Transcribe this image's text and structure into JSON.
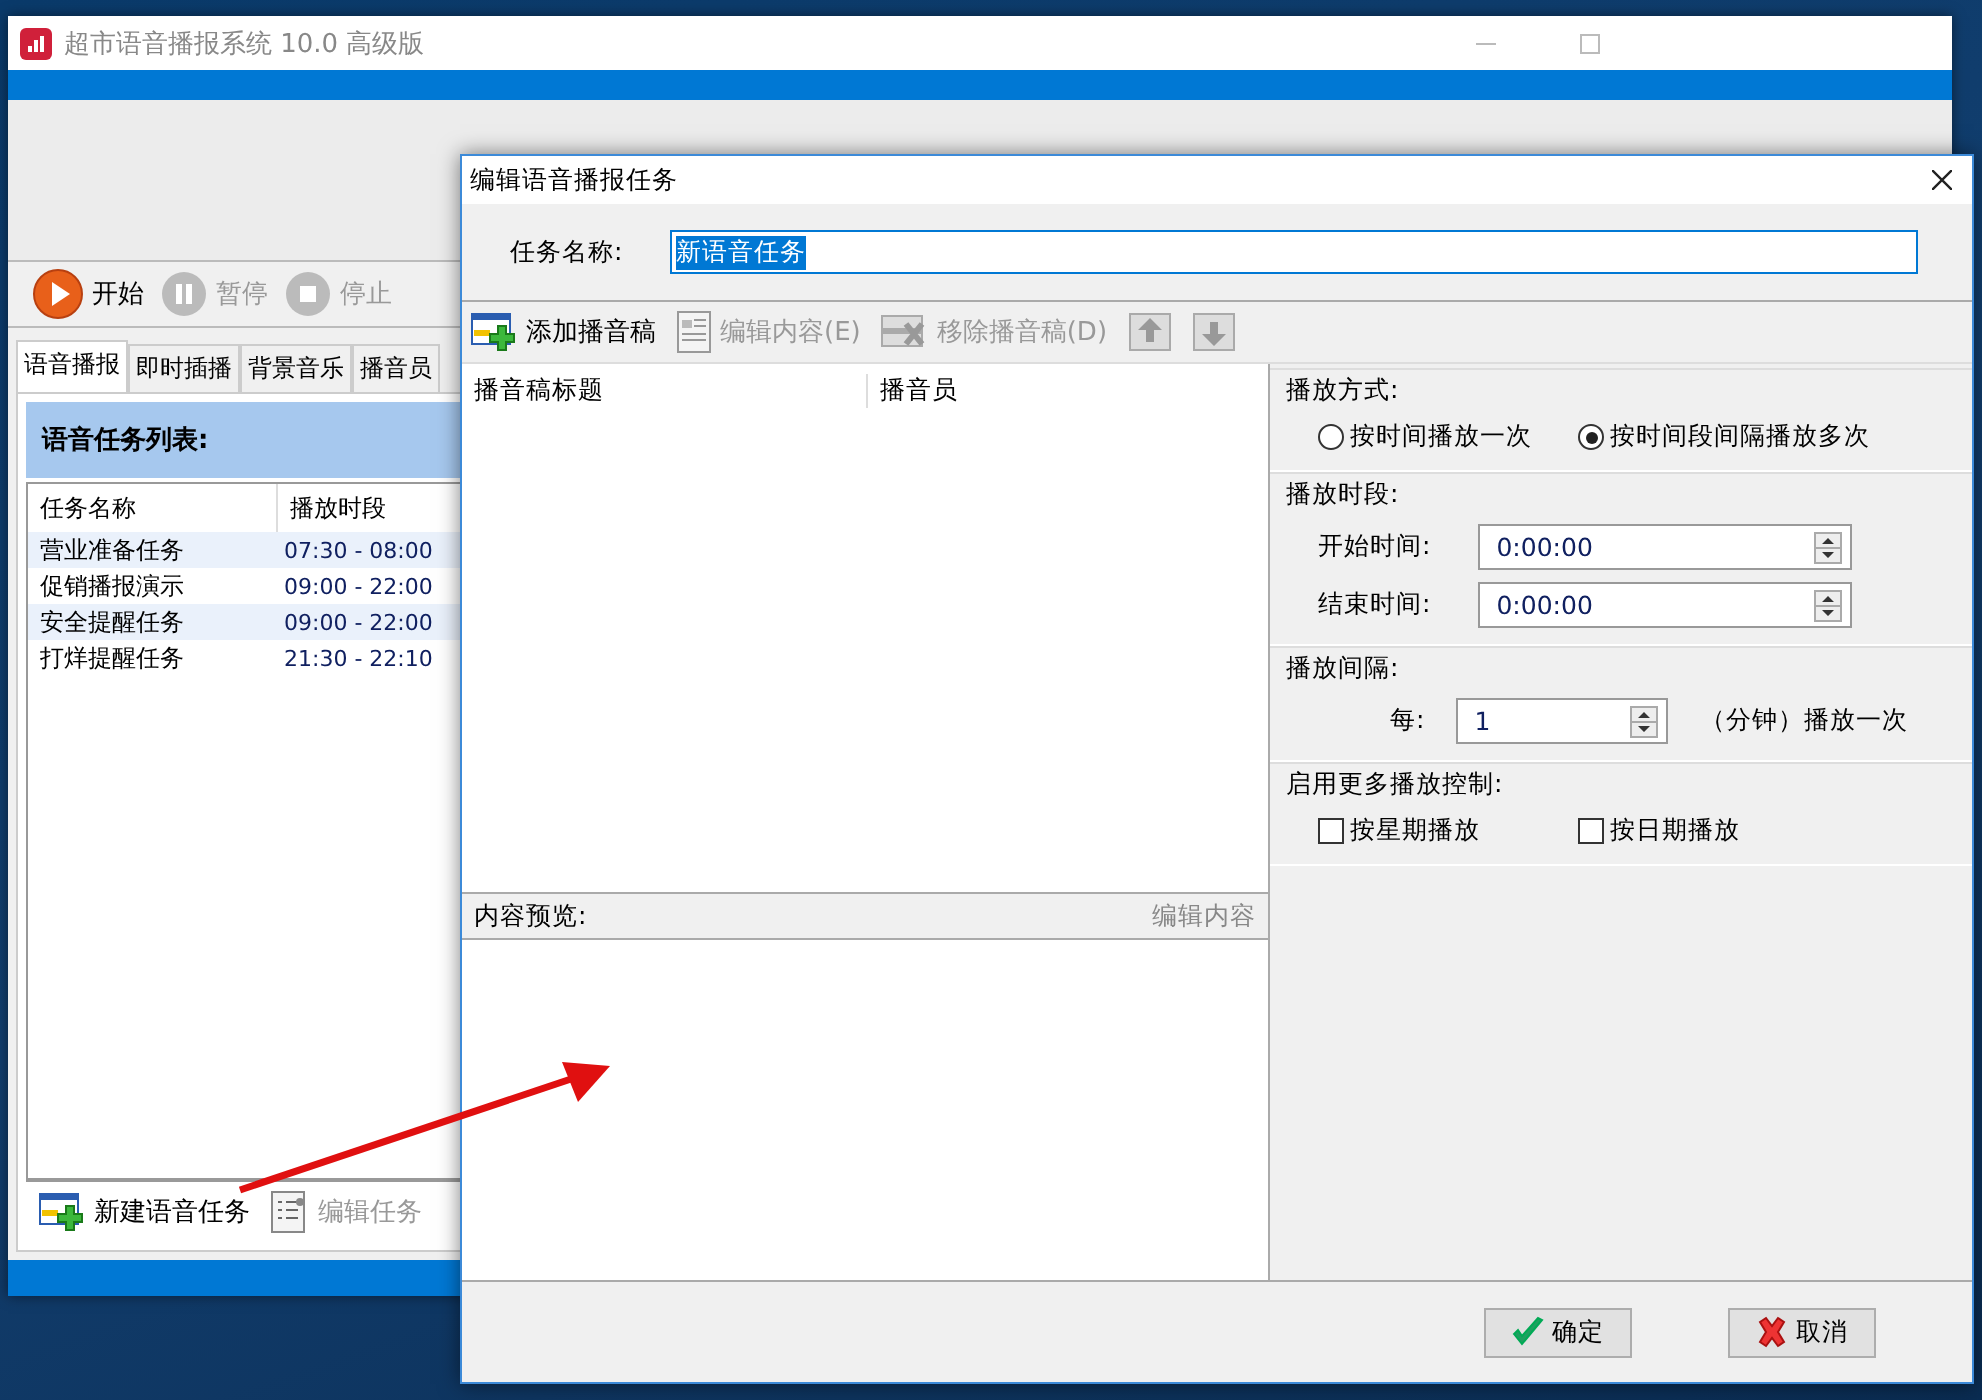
{
  "main_window": {
    "title": "超市语音播报系统 10.0 高级版",
    "toolbar": [
      {
        "kind": "play",
        "label": "开始",
        "disabled": false
      },
      {
        "kind": "pause",
        "label": "暂停",
        "disabled": true
      },
      {
        "kind": "stop",
        "label": "停止",
        "disabled": true
      }
    ],
    "tabs": [
      {
        "label": "语音播报",
        "selected": true
      },
      {
        "label": "即时插播",
        "selected": false
      },
      {
        "label": "背景音乐",
        "selected": false
      },
      {
        "label": "播音员",
        "selected": false
      }
    ],
    "panel_title": "语音任务列表:",
    "task_table": {
      "columns": [
        "任务名称",
        "播放时段"
      ],
      "rows": [
        {
          "name": "营业准备任务",
          "period": "07:30 - 08:00"
        },
        {
          "name": "促销播报演示",
          "period": "09:00 - 22:00"
        },
        {
          "name": "安全提醒任务",
          "period": "09:00 - 22:00"
        },
        {
          "name": "打烊提醒任务",
          "period": "21:30 - 22:10"
        }
      ]
    },
    "bottom_toolbar": [
      {
        "kind": "add",
        "label": "新建语音任务",
        "disabled": false
      },
      {
        "kind": "edit",
        "label": "编辑任务",
        "disabled": true
      }
    ]
  },
  "dialog": {
    "title": "编辑语音播报任务",
    "name_label": "任务名称:",
    "name_value": "新语音任务",
    "toolbar": [
      {
        "kind": "add",
        "label": "添加播音稿",
        "disabled": false
      },
      {
        "kind": "doc",
        "label": "编辑内容(E)",
        "disabled": true
      },
      {
        "kind": "remove",
        "label": "移除播音稿(D)",
        "disabled": true
      },
      {
        "kind": "up",
        "disabled": true
      },
      {
        "kind": "down",
        "disabled": true
      }
    ],
    "script_list": {
      "columns": [
        "播音稿标题",
        "播音员"
      ]
    },
    "preview": {
      "label": "内容预览:",
      "action": "编辑内容"
    },
    "play_mode": {
      "title": "播放方式:",
      "options": [
        {
          "label": "按时间播放一次",
          "selected": false
        },
        {
          "label": "按时间段间隔播放多次",
          "selected": true
        }
      ]
    },
    "play_period": {
      "title": "播放时段:",
      "fields": [
        {
          "label": "开始时间:",
          "value": "0:00:00"
        },
        {
          "label": "结束时间:",
          "value": "0:00:00"
        }
      ]
    },
    "interval": {
      "title": "播放间隔:",
      "label": "每:",
      "value": "1",
      "unit": "（分钟）播放一次"
    },
    "more_control": {
      "title": "启用更多播放控制:",
      "options": [
        {
          "label": "按星期播放",
          "checked": false
        },
        {
          "label": "按日期播放",
          "checked": false
        }
      ]
    },
    "buttons": [
      {
        "kind": "ok",
        "label": "确定"
      },
      {
        "kind": "cancel",
        "label": "取消"
      }
    ]
  }
}
